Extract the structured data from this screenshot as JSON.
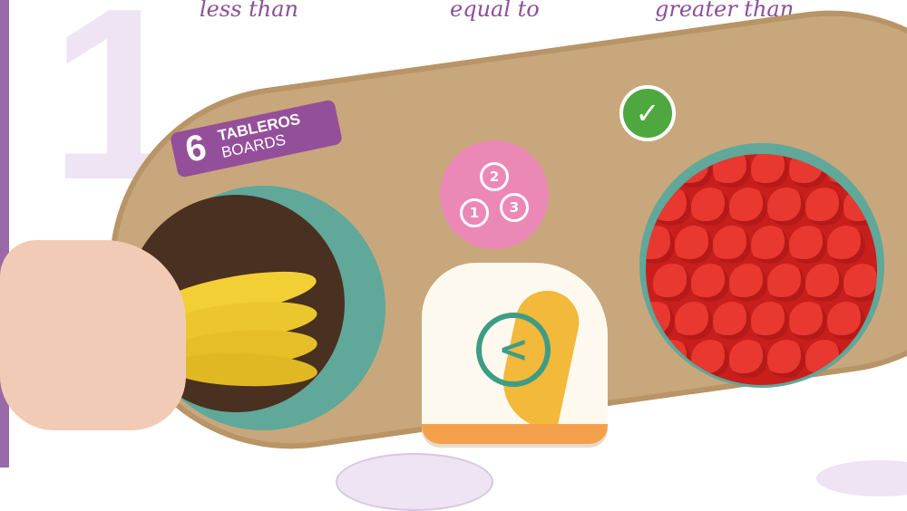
{
  "captions": [
    "less than",
    "equal to",
    "greater than"
  ],
  "step_number": "1",
  "badge": {
    "count": "6",
    "line1": "TABLEROS",
    "line2": "BOARDS"
  },
  "token_numbers": [
    "2",
    "1",
    "3"
  ],
  "comparison_symbol": "<",
  "icons": {
    "check": "check-icon"
  },
  "colors": {
    "accent_purple": "#944f9a",
    "board": "#c9a77c",
    "well": "#5fa89a",
    "check_green": "#4fa83f",
    "token_pink": "#eb88b6"
  }
}
